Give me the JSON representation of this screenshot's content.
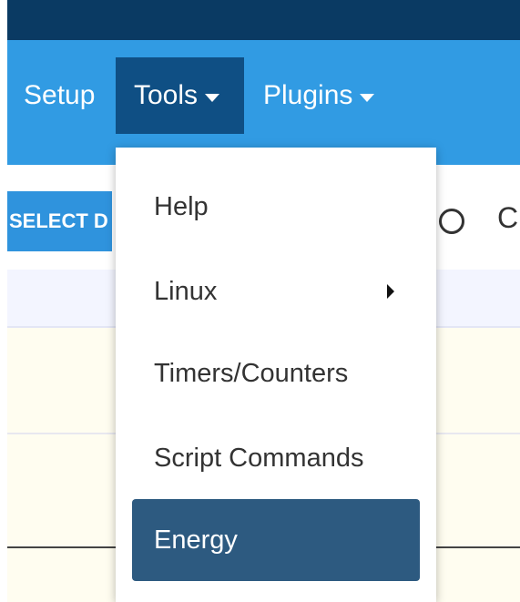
{
  "navbar": {
    "items": [
      {
        "label": "Setup"
      },
      {
        "label": "Tools"
      },
      {
        "label": "Plugins"
      }
    ]
  },
  "toolbar": {
    "select_button_label": "SELECT D",
    "radio_label": "C"
  },
  "tools_menu": {
    "items": [
      {
        "label": "Help"
      },
      {
        "label": "Linux"
      },
      {
        "label": "Timers/Counters"
      },
      {
        "label": "Script Commands"
      },
      {
        "label": "Energy"
      }
    ]
  },
  "colors": {
    "top_strip": "#0a3a63",
    "navbar": "#319be3",
    "nav_active": "#0f4f84",
    "menu_highlight": "#2d5a80"
  }
}
